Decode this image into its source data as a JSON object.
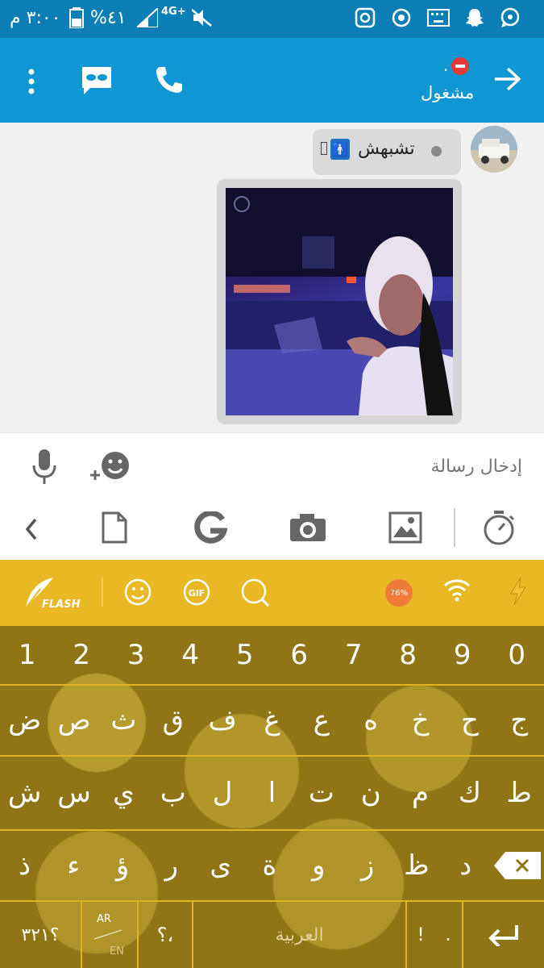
{
  "status_bar": {
    "time": "٣:٠٠ م",
    "battery": "%٤١",
    "network": "4G+"
  },
  "app_bar": {
    "contact_status": "مشغول",
    "contact_dot": "."
  },
  "chat": {
    "message_text": "تشبهش",
    "message_emoji": "🚹"
  },
  "input": {
    "placeholder": "إدخال رسالة"
  },
  "keyboard": {
    "brand": "FLASH",
    "battery_badge": "76%",
    "number_row": [
      "1",
      "2",
      "3",
      "4",
      "5",
      "6",
      "7",
      "8",
      "9",
      "0"
    ],
    "row1": [
      "ض",
      "ص",
      "ث",
      "ق",
      "ف",
      "غ",
      "ع",
      "ه",
      "خ",
      "ح",
      "ج"
    ],
    "row2": [
      "ش",
      "س",
      "ي",
      "ب",
      "ل",
      "ا",
      "ت",
      "ن",
      "م",
      "ك",
      "ط"
    ],
    "row3": [
      "ذ",
      "ء",
      "ؤ",
      "ر",
      "ى",
      "ة",
      "و",
      "ز",
      "ظ",
      "د"
    ],
    "symbols_key": "؟٣٢١",
    "lang_ar": "AR",
    "lang_en": "EN",
    "punct_key": "؟،",
    "space_label": "العربية",
    "excl_key": "!",
    "dot_key": "."
  },
  "colors": {
    "status_bar": "#0b7fb5",
    "app_bar": "#0e97d2",
    "keyboard_top": "#e8b825",
    "keyboard_bg": "#8f7516"
  }
}
